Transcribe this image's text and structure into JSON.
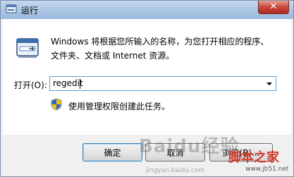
{
  "window": {
    "title": "运行"
  },
  "description": {
    "line1": "Windows 将根据您所输入的名称，为您打开相应的程序、",
    "line2": "文件夹、文档或 Internet 资源。"
  },
  "open_field": {
    "label": "打开(O):",
    "value": "regedit"
  },
  "admin_note": "使用管理权限创建此任务。",
  "buttons": {
    "ok": "确定",
    "cancel": "取消",
    "browse": "浏览(B)..."
  },
  "watermark": {
    "text": "Baidu经验",
    "sub": "jingyan.baidu.com",
    "brand": "脚本之家",
    "url": "www.jb51.net"
  },
  "colors": {
    "title_gradient_top": "#c5d9ef",
    "close_red": "#c6483b",
    "input_border": "#5b9bd5"
  }
}
